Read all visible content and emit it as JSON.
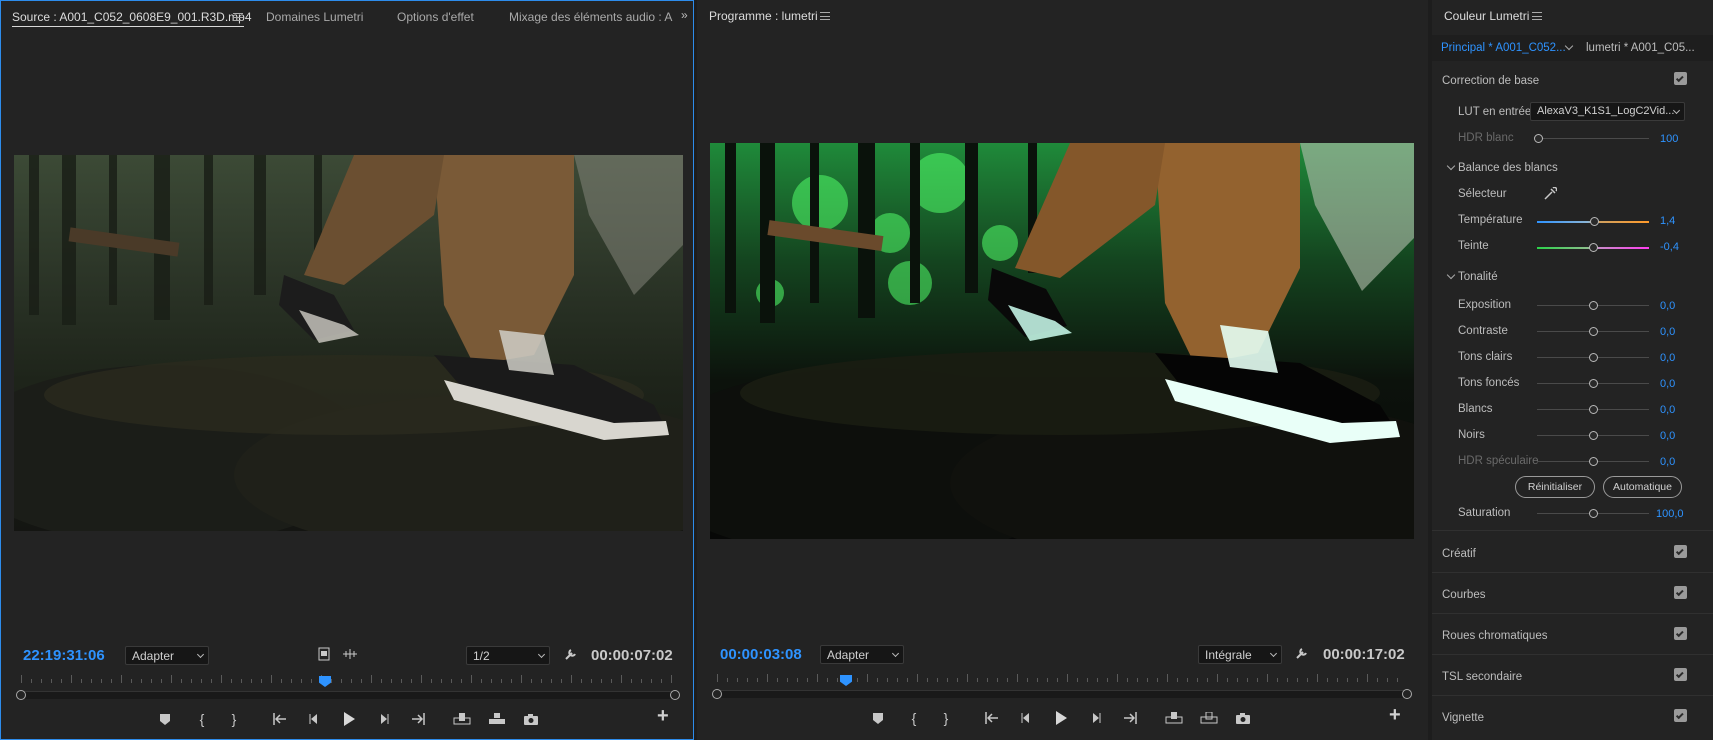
{
  "source": {
    "tabs": [
      "Source : A001_C052_0608E9_001.R3D.mp4",
      "Domaines Lumetri",
      "Options d'effet",
      "Mixage des éléments audio : A"
    ],
    "timecode_current": "22:19:31:06",
    "fit": "Adapter",
    "resolution": "1/2",
    "timecode_duration": "00:00:07:02",
    "playhead_fraction": 0.46
  },
  "program": {
    "title": "Programme : lumetri",
    "timecode_current": "00:00:03:08",
    "fit": "Adapter",
    "resolution": "Intégrale",
    "timecode_duration": "00:00:17:02",
    "playhead_fraction": 0.19
  },
  "lumetri": {
    "title": "Couleur Lumetri",
    "tab_main": "Principal * A001_C052...",
    "tab_second": "lumetri * A001_C05...",
    "basic_correction": "Correction de base",
    "lut_label": "LUT en entrée",
    "lut_value": "AlexaV3_K1S1_LogC2Vid...",
    "hdr_white_label": "HDR blanc",
    "hdr_white_value": "100",
    "white_balance": "Balance des blancs",
    "selector_label": "Sélecteur",
    "temperature_label": "Température",
    "temperature_value": "1,4",
    "tint_label": "Teinte",
    "tint_value": "-0,4",
    "tone": "Tonalité",
    "sliders": [
      {
        "label": "Exposition",
        "value": "0,0",
        "dim": false
      },
      {
        "label": "Contraste",
        "value": "0,0",
        "dim": false
      },
      {
        "label": "Tons clairs",
        "value": "0,0",
        "dim": false
      },
      {
        "label": "Tons foncés",
        "value": "0,0",
        "dim": false
      },
      {
        "label": "Blancs",
        "value": "0,0",
        "dim": false
      },
      {
        "label": "Noirs",
        "value": "0,0",
        "dim": false
      },
      {
        "label": "HDR spéculaire",
        "value": "0,0",
        "dim": true
      }
    ],
    "reset_button": "Réinitialiser",
    "auto_button": "Automatique",
    "saturation_label": "Saturation",
    "saturation_value": "100,0",
    "sections": [
      "Créatif",
      "Courbes",
      "Roues chromatiques",
      "TSL secondaire",
      "Vignette"
    ]
  },
  "colors": {
    "accent": "#2e93ff",
    "panel_bg": "#232323",
    "active_border": "#2d8ceb"
  }
}
